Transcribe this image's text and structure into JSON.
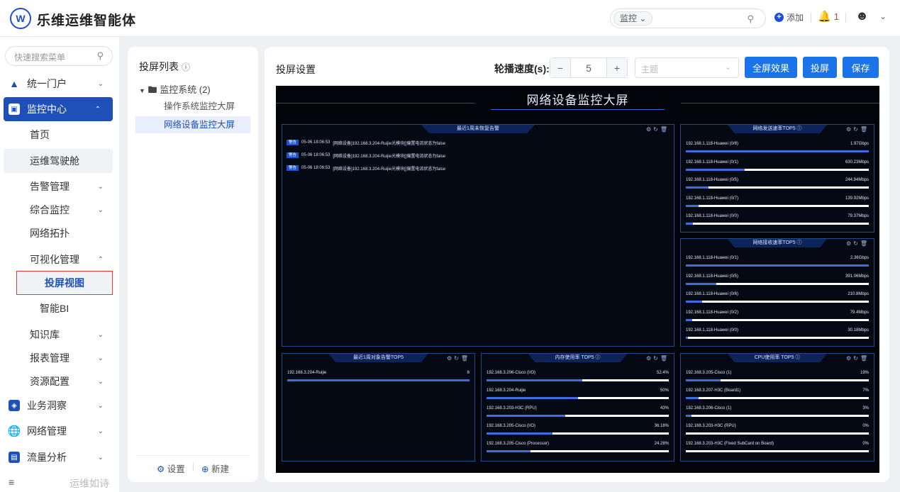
{
  "app": {
    "logo_text": "W",
    "brand": "乐维运维智能体"
  },
  "header": {
    "search_scope": "监控",
    "search_placeholder": "",
    "add_label": "添加",
    "alert_count": "1"
  },
  "sidebar": {
    "search_placeholder": "快速搜索菜单",
    "items": [
      {
        "label": "统一门户"
      },
      {
        "label": "监控中心"
      },
      {
        "label": "首页"
      },
      {
        "label": "运维驾驶舱"
      },
      {
        "label": "告警管理"
      },
      {
        "label": "综合监控"
      },
      {
        "label": "网络拓扑"
      },
      {
        "label": "可视化管理"
      },
      {
        "label": "投屏视图"
      },
      {
        "label": "智能BI"
      },
      {
        "label": "知识库"
      },
      {
        "label": "报表管理"
      },
      {
        "label": "资源配置"
      },
      {
        "label": "业务洞察"
      },
      {
        "label": "网络管理"
      },
      {
        "label": "流量分析"
      }
    ],
    "bottom_text": "运维如诗"
  },
  "list_panel": {
    "title": "投屏列表",
    "group": "监控系统 (2)",
    "items": [
      "操作系统监控大屏",
      "网络设备监控大屏"
    ],
    "footer_settings": "设置",
    "footer_new": "新建"
  },
  "main": {
    "title": "投屏设置",
    "speed_label": "轮播速度(s):",
    "speed_value": "5",
    "theme_placeholder": "主题",
    "btn_fullscreen": "全屏效果",
    "btn_cast": "投屏",
    "btn_save": "保存"
  },
  "screen": {
    "title": "网络设备监控大屏",
    "alarm_panel": {
      "title": "最近1周未恢复告警",
      "items": [
        {
          "tag": "警告",
          "time": "05-06 18:06:53",
          "text": "[网络设备]192.168.3.204-Ruijie光模块[]偏置电流状态为false"
        },
        {
          "tag": "警告",
          "time": "05-06 18:06:53",
          "text": "[网络设备]192.168.3.204-Ruijie光模块[]偏置电流状态为false"
        },
        {
          "tag": "警告",
          "time": "05-06 18:06:53",
          "text": "[网络设备]192.168.3.204-Ruijie光模块[]偏置电流状态为false"
        }
      ]
    },
    "send_panel": {
      "title": "网络发送速率TOP5 ⓘ",
      "rows": [
        {
          "name": "192.168.1.118-Huawei (0/6)",
          "value": "1.97Gbps",
          "pct": 100
        },
        {
          "name": "192.168.1.118-Huawei (0/1)",
          "value": "630.23Mbps",
          "pct": 32
        },
        {
          "name": "192.168.1.118-Huawei (0/5)",
          "value": "244.94Mbps",
          "pct": 12.4
        },
        {
          "name": "192.168.1.118-Huawei (0/7)",
          "value": "139.92Mbps",
          "pct": 7.1
        },
        {
          "name": "192.168.1.118-Huawei (0/0)",
          "value": "79.37Mbps",
          "pct": 4
        }
      ]
    },
    "recv_panel": {
      "title": "网络接收速率TOP5 ⓘ",
      "rows": [
        {
          "name": "192.168.1.118-Huawei (0/1)",
          "value": "2.36Gbps",
          "pct": 100
        },
        {
          "name": "192.168.1.118-Huawei (0/5)",
          "value": "391.06Mbps",
          "pct": 16.6
        },
        {
          "name": "192.168.1.118-Huawei (0/6)",
          "value": "210.8Mbps",
          "pct": 8.9
        },
        {
          "name": "192.168.1.118-Huawei (0/2)",
          "value": "79.4Mbps",
          "pct": 3.4
        },
        {
          "name": "192.168.1.118-Huawei (0/0)",
          "value": "30.18Mbps",
          "pct": 1.3
        }
      ]
    },
    "obj_panel": {
      "title": "最近1周对象告警TOP5",
      "rows": [
        {
          "name": "192.168.3.204-Ruijie",
          "value": "6",
          "pct": 100
        }
      ]
    },
    "mem_panel": {
      "title": "内存使用率 TOP5 ⓘ",
      "rows": [
        {
          "name": "192.168.3.206-Cisco (I/O)",
          "value": "52.4%",
          "pct": 52.4
        },
        {
          "name": "192.168.3.204-Ruijie",
          "value": "50%",
          "pct": 50
        },
        {
          "name": "192.168.3.203-H3C (RPU)",
          "value": "43%",
          "pct": 43
        },
        {
          "name": "192.168.3.205-Cisco (I/O)",
          "value": "36.18%",
          "pct": 36.18
        },
        {
          "name": "192.168.3.205-Cisco (Processor)",
          "value": "24.28%",
          "pct": 24.28
        }
      ]
    },
    "cpu_panel": {
      "title": "CPU使用率 TOP5 ⓘ",
      "rows": [
        {
          "name": "192.168.3.205-Cisco (1)",
          "value": "19%",
          "pct": 19
        },
        {
          "name": "192.168.3.207-H3C (Board1)",
          "value": "7%",
          "pct": 7
        },
        {
          "name": "192.168.3.206-Cisco (1)",
          "value": "3%",
          "pct": 3
        },
        {
          "name": "192.168.3.203-H3C (RPU)",
          "value": "0%",
          "pct": 0
        },
        {
          "name": "192.168.3.203-H3C (Fixed SubCard on Board)",
          "value": "0%",
          "pct": 0
        }
      ]
    }
  }
}
